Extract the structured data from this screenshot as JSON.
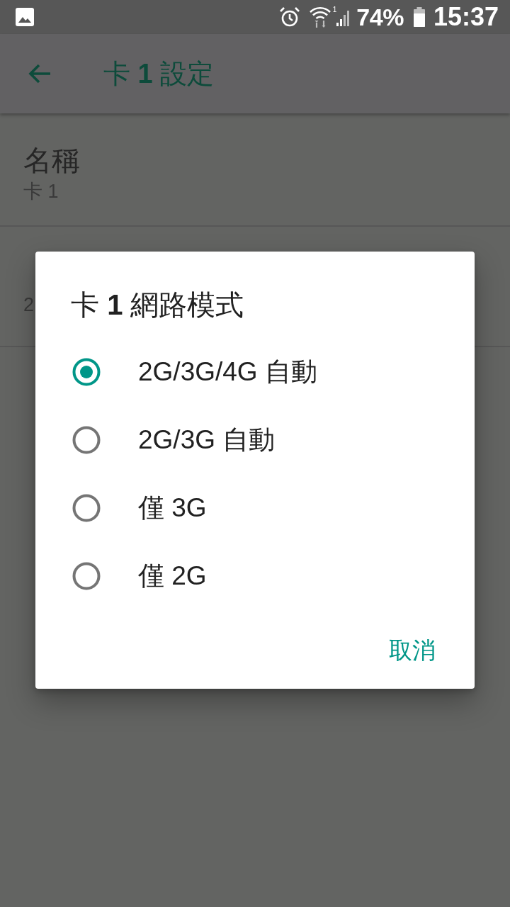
{
  "status_bar": {
    "signal_label": "1",
    "battery": "74%",
    "time": "15:37"
  },
  "app_bar": {
    "title": "卡 **1** 設定"
  },
  "preferences": [
    {
      "title": "名稱",
      "summary": "卡 1"
    },
    {
      "summary": "2"
    }
  ],
  "dialog": {
    "title": "卡 **1** 網路模式",
    "options": [
      {
        "label": "2G/3G/4G 自動",
        "selected": true
      },
      {
        "label": "2G/3G 自動",
        "selected": false
      },
      {
        "label": "僅 3G",
        "selected": false
      },
      {
        "label": "僅 2G",
        "selected": false
      }
    ],
    "buttons": [
      "取消"
    ]
  }
}
